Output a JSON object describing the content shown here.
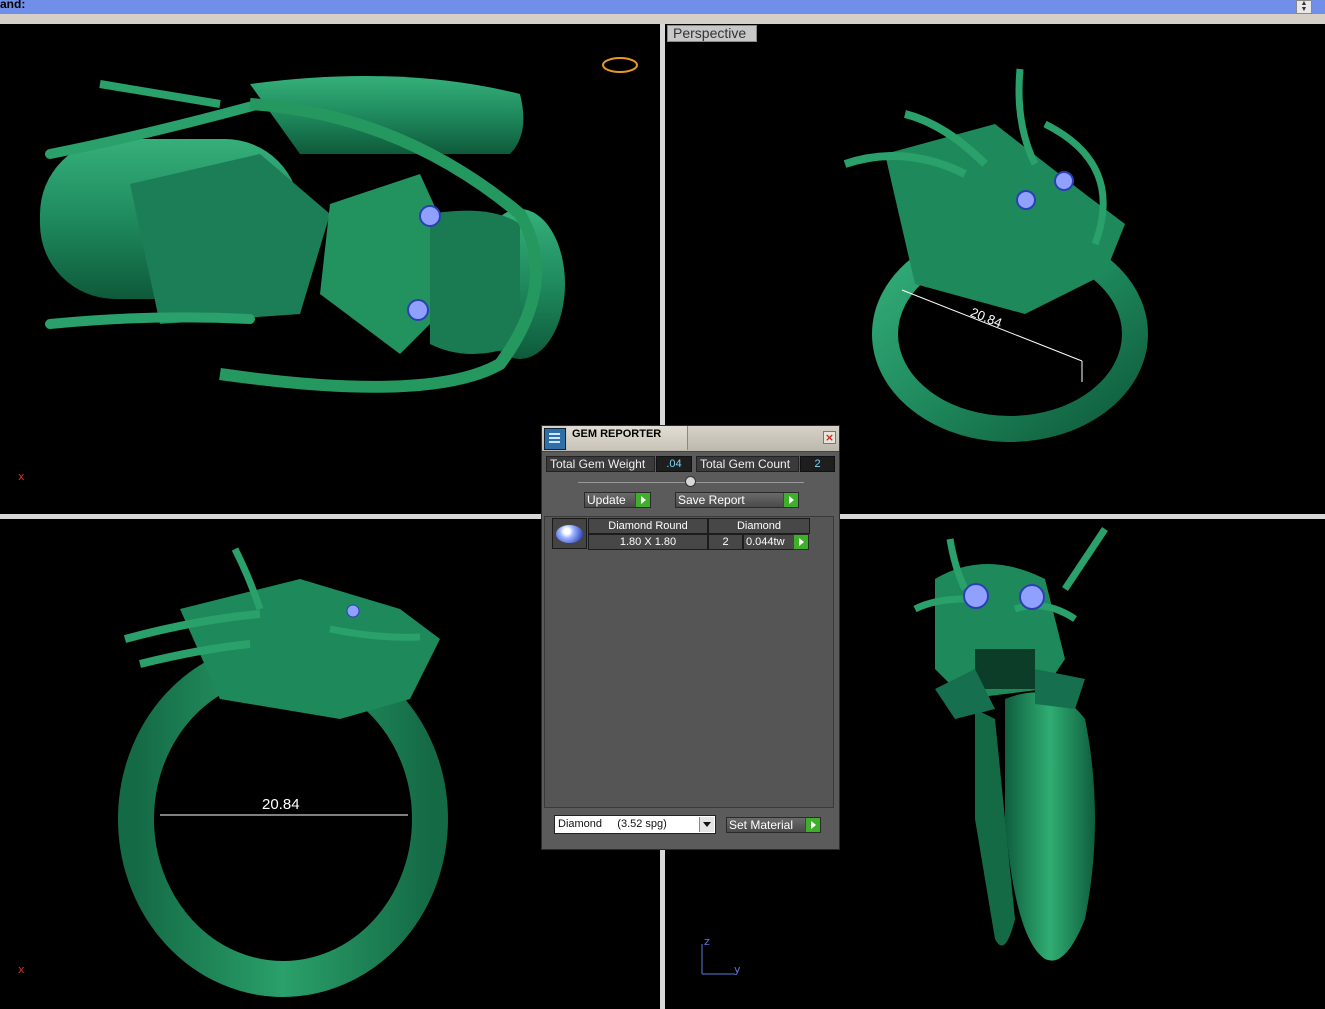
{
  "command_bar": {
    "label": "and:"
  },
  "viewports": {
    "top_left": {
      "axis_label": "x"
    },
    "top_right": {
      "label": "Perspective",
      "dimension": "20.84"
    },
    "bottom_left": {
      "axis_label": "x",
      "dimension": "20.84"
    },
    "bottom_right": {
      "axis_z": "z",
      "axis_y": "y"
    }
  },
  "gem_reporter": {
    "title": "GEM REPORTER",
    "total_weight_label": "Total Gem Weight",
    "total_weight_value": ".04",
    "total_count_label": "Total Gem Count",
    "total_count_value": "2",
    "update_label": "Update",
    "save_report_label": "Save Report",
    "table": {
      "header": {
        "shape": "Diamond Round",
        "material": "Diamond"
      },
      "rows": [
        {
          "size": "1.80 X 1.80",
          "count": "2",
          "weight": "0.044tw"
        }
      ]
    },
    "material_select": {
      "value": "Diamond     (3.52 spg)"
    },
    "set_material_label": "Set Material"
  },
  "colors": {
    "model": "#1f8a5e",
    "background": "#000000",
    "panel": "#5b5b5b",
    "accent_go": "#3fae2a",
    "value_text": "#7ad8ff"
  }
}
